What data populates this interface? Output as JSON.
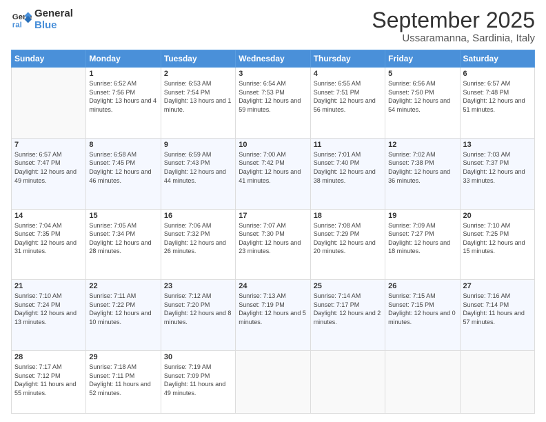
{
  "logo": {
    "line1": "General",
    "line2": "Blue"
  },
  "title": "September 2025",
  "location": "Ussaramanna, Sardinia, Italy",
  "days_header": [
    "Sunday",
    "Monday",
    "Tuesday",
    "Wednesday",
    "Thursday",
    "Friday",
    "Saturday"
  ],
  "weeks": [
    [
      {
        "num": "",
        "sunrise": "",
        "sunset": "",
        "daylight": ""
      },
      {
        "num": "1",
        "sunrise": "Sunrise: 6:52 AM",
        "sunset": "Sunset: 7:56 PM",
        "daylight": "Daylight: 13 hours and 4 minutes."
      },
      {
        "num": "2",
        "sunrise": "Sunrise: 6:53 AM",
        "sunset": "Sunset: 7:54 PM",
        "daylight": "Daylight: 13 hours and 1 minute."
      },
      {
        "num": "3",
        "sunrise": "Sunrise: 6:54 AM",
        "sunset": "Sunset: 7:53 PM",
        "daylight": "Daylight: 12 hours and 59 minutes."
      },
      {
        "num": "4",
        "sunrise": "Sunrise: 6:55 AM",
        "sunset": "Sunset: 7:51 PM",
        "daylight": "Daylight: 12 hours and 56 minutes."
      },
      {
        "num": "5",
        "sunrise": "Sunrise: 6:56 AM",
        "sunset": "Sunset: 7:50 PM",
        "daylight": "Daylight: 12 hours and 54 minutes."
      },
      {
        "num": "6",
        "sunrise": "Sunrise: 6:57 AM",
        "sunset": "Sunset: 7:48 PM",
        "daylight": "Daylight: 12 hours and 51 minutes."
      }
    ],
    [
      {
        "num": "7",
        "sunrise": "Sunrise: 6:57 AM",
        "sunset": "Sunset: 7:47 PM",
        "daylight": "Daylight: 12 hours and 49 minutes."
      },
      {
        "num": "8",
        "sunrise": "Sunrise: 6:58 AM",
        "sunset": "Sunset: 7:45 PM",
        "daylight": "Daylight: 12 hours and 46 minutes."
      },
      {
        "num": "9",
        "sunrise": "Sunrise: 6:59 AM",
        "sunset": "Sunset: 7:43 PM",
        "daylight": "Daylight: 12 hours and 44 minutes."
      },
      {
        "num": "10",
        "sunrise": "Sunrise: 7:00 AM",
        "sunset": "Sunset: 7:42 PM",
        "daylight": "Daylight: 12 hours and 41 minutes."
      },
      {
        "num": "11",
        "sunrise": "Sunrise: 7:01 AM",
        "sunset": "Sunset: 7:40 PM",
        "daylight": "Daylight: 12 hours and 38 minutes."
      },
      {
        "num": "12",
        "sunrise": "Sunrise: 7:02 AM",
        "sunset": "Sunset: 7:38 PM",
        "daylight": "Daylight: 12 hours and 36 minutes."
      },
      {
        "num": "13",
        "sunrise": "Sunrise: 7:03 AM",
        "sunset": "Sunset: 7:37 PM",
        "daylight": "Daylight: 12 hours and 33 minutes."
      }
    ],
    [
      {
        "num": "14",
        "sunrise": "Sunrise: 7:04 AM",
        "sunset": "Sunset: 7:35 PM",
        "daylight": "Daylight: 12 hours and 31 minutes."
      },
      {
        "num": "15",
        "sunrise": "Sunrise: 7:05 AM",
        "sunset": "Sunset: 7:34 PM",
        "daylight": "Daylight: 12 hours and 28 minutes."
      },
      {
        "num": "16",
        "sunrise": "Sunrise: 7:06 AM",
        "sunset": "Sunset: 7:32 PM",
        "daylight": "Daylight: 12 hours and 26 minutes."
      },
      {
        "num": "17",
        "sunrise": "Sunrise: 7:07 AM",
        "sunset": "Sunset: 7:30 PM",
        "daylight": "Daylight: 12 hours and 23 minutes."
      },
      {
        "num": "18",
        "sunrise": "Sunrise: 7:08 AM",
        "sunset": "Sunset: 7:29 PM",
        "daylight": "Daylight: 12 hours and 20 minutes."
      },
      {
        "num": "19",
        "sunrise": "Sunrise: 7:09 AM",
        "sunset": "Sunset: 7:27 PM",
        "daylight": "Daylight: 12 hours and 18 minutes."
      },
      {
        "num": "20",
        "sunrise": "Sunrise: 7:10 AM",
        "sunset": "Sunset: 7:25 PM",
        "daylight": "Daylight: 12 hours and 15 minutes."
      }
    ],
    [
      {
        "num": "21",
        "sunrise": "Sunrise: 7:10 AM",
        "sunset": "Sunset: 7:24 PM",
        "daylight": "Daylight: 12 hours and 13 minutes."
      },
      {
        "num": "22",
        "sunrise": "Sunrise: 7:11 AM",
        "sunset": "Sunset: 7:22 PM",
        "daylight": "Daylight: 12 hours and 10 minutes."
      },
      {
        "num": "23",
        "sunrise": "Sunrise: 7:12 AM",
        "sunset": "Sunset: 7:20 PM",
        "daylight": "Daylight: 12 hours and 8 minutes."
      },
      {
        "num": "24",
        "sunrise": "Sunrise: 7:13 AM",
        "sunset": "Sunset: 7:19 PM",
        "daylight": "Daylight: 12 hours and 5 minutes."
      },
      {
        "num": "25",
        "sunrise": "Sunrise: 7:14 AM",
        "sunset": "Sunset: 7:17 PM",
        "daylight": "Daylight: 12 hours and 2 minutes."
      },
      {
        "num": "26",
        "sunrise": "Sunrise: 7:15 AM",
        "sunset": "Sunset: 7:15 PM",
        "daylight": "Daylight: 12 hours and 0 minutes."
      },
      {
        "num": "27",
        "sunrise": "Sunrise: 7:16 AM",
        "sunset": "Sunset: 7:14 PM",
        "daylight": "Daylight: 11 hours and 57 minutes."
      }
    ],
    [
      {
        "num": "28",
        "sunrise": "Sunrise: 7:17 AM",
        "sunset": "Sunset: 7:12 PM",
        "daylight": "Daylight: 11 hours and 55 minutes."
      },
      {
        "num": "29",
        "sunrise": "Sunrise: 7:18 AM",
        "sunset": "Sunset: 7:11 PM",
        "daylight": "Daylight: 11 hours and 52 minutes."
      },
      {
        "num": "30",
        "sunrise": "Sunrise: 7:19 AM",
        "sunset": "Sunset: 7:09 PM",
        "daylight": "Daylight: 11 hours and 49 minutes."
      },
      {
        "num": "",
        "sunrise": "",
        "sunset": "",
        "daylight": ""
      },
      {
        "num": "",
        "sunrise": "",
        "sunset": "",
        "daylight": ""
      },
      {
        "num": "",
        "sunrise": "",
        "sunset": "",
        "daylight": ""
      },
      {
        "num": "",
        "sunrise": "",
        "sunset": "",
        "daylight": ""
      }
    ]
  ]
}
